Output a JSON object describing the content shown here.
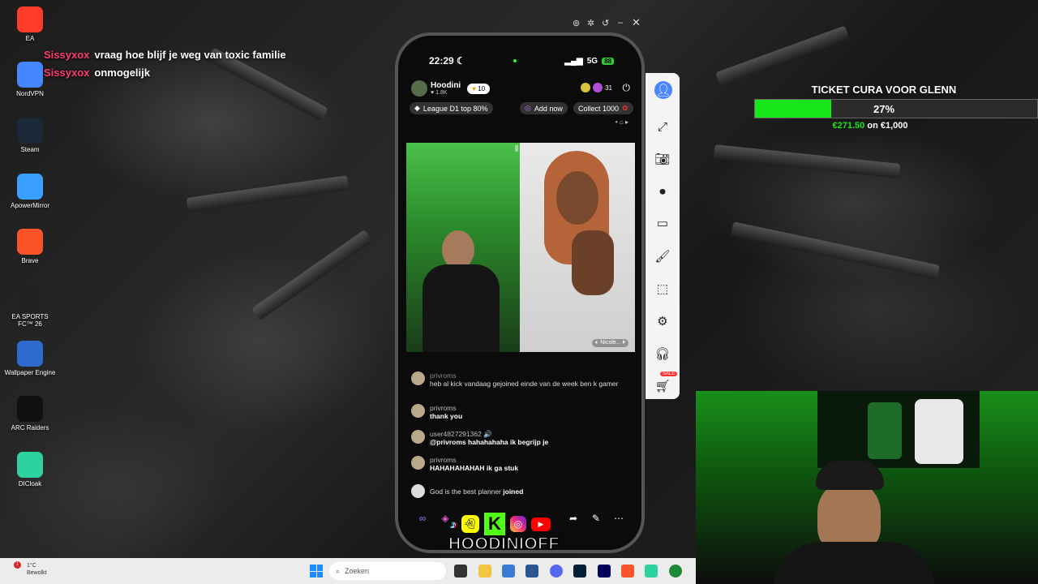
{
  "desktop": {
    "icons": [
      {
        "label": "EA",
        "icon": "ea-icon",
        "color": "#ff3c2a"
      },
      {
        "label": "NordVPN",
        "icon": "nordvpn-icon",
        "color": "#4687ff"
      },
      {
        "label": "Steam",
        "icon": "steam-icon",
        "color": "#1b2838"
      },
      {
        "label": "ApowerMirror",
        "icon": "apowermirror-icon",
        "color": "#3aa0ff"
      },
      {
        "label": "Brave",
        "icon": "brave-icon",
        "color": "#fb542b"
      },
      {
        "label": "EA SPORTS FC™ 26",
        "icon": "easportsfc-icon",
        "color": "#222"
      },
      {
        "label": "Wallpaper Engine",
        "icon": "wallpaper-engine-icon",
        "color": "#2d6bcf"
      },
      {
        "label": "ARC Raiders",
        "icon": "arc-raiders-icon",
        "color": "#111"
      },
      {
        "label": "DICloak",
        "icon": "dicloak-icon",
        "color": "#2ed1a0"
      }
    ]
  },
  "chat_overlay": [
    {
      "user": "Sissyxox",
      "text": "vraag hoe blijf je weg van toxic familie"
    },
    {
      "user": "Sissyxox",
      "text": "onmogelijk"
    }
  ],
  "phone": {
    "time": "22:29",
    "network": "5G",
    "battery": "88",
    "host": {
      "name": "Hoodini",
      "likes": "1.8K",
      "hearts": "10"
    },
    "viewers": "31",
    "league": "League D1 top 80%",
    "add_now": "Add now",
    "collect": "Collect 1000",
    "guest_label": "Nicole...",
    "comments": [
      {
        "user": "privroms",
        "text": "heb al kick vandaag gejoined einde van de week ben k gamer"
      },
      {
        "user": "privroms",
        "text": "thank you"
      },
      {
        "user": "user4827291362 🔊",
        "text": "@privroms hahahahaha ik begrijp je"
      },
      {
        "user": "privroms",
        "text": "HAHAHAHAHAH ik ga stuk"
      },
      {
        "user": "",
        "text": "God is the best planner",
        "suffix": "joined"
      }
    ]
  },
  "branding": {
    "name": "HOODINIOFF"
  },
  "goal": {
    "title": "TICKET CURA VOOR GLENN",
    "percent_label": "27%",
    "progress": 0.27,
    "amount": "€271.50",
    "amount_suffix": "on €1,000",
    "fill_color": "#19e619"
  },
  "toolbar": {
    "sale_badge": "SALE",
    "items": [
      "avatar-icon",
      "expand-icon",
      "camera-icon",
      "record-icon",
      "screen-icon",
      "brush-icon",
      "select-icon",
      "settings-icon",
      "headset-icon",
      "cart-icon"
    ]
  },
  "taskbar": {
    "weather_temp": "1°C",
    "weather_text": "Bewolkt",
    "search_placeholder": "Zoeken",
    "notification_count": "1"
  }
}
